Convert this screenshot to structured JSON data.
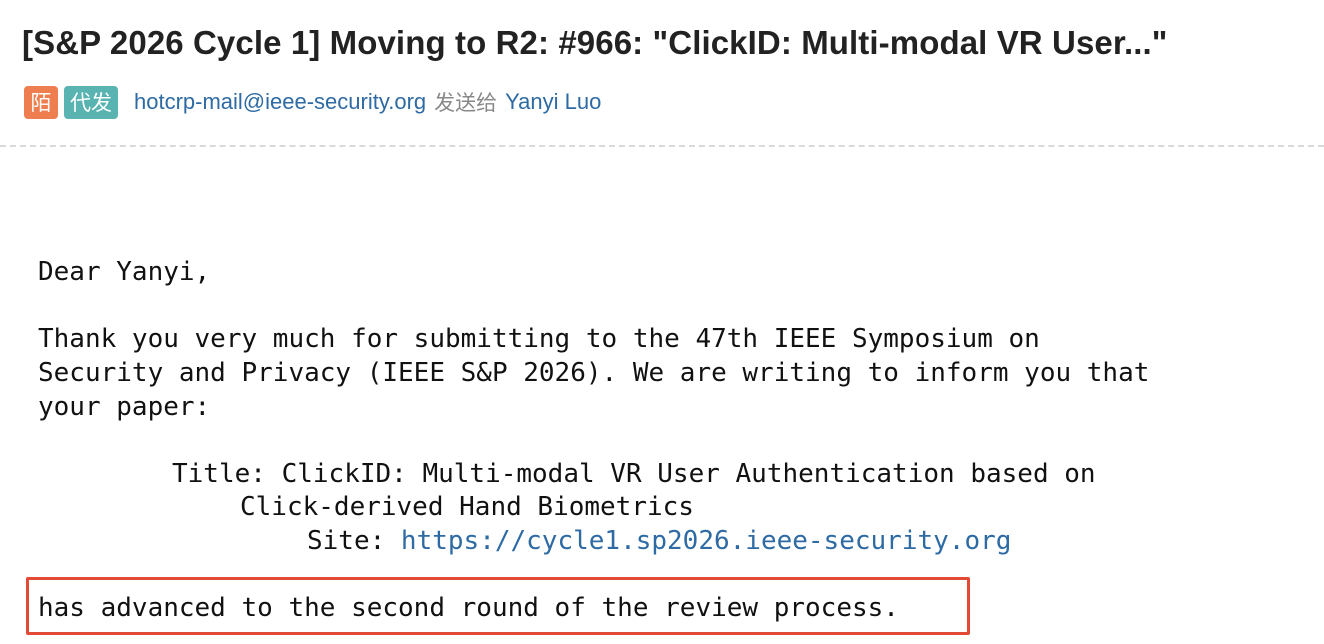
{
  "email": {
    "subject": "[S&P 2026 Cycle 1] Moving to R2: #966: \"ClickID: Multi-modal VR User...\"",
    "tags": {
      "stranger": "陌",
      "proxy": "代发"
    },
    "sender": "hotcrp-mail@ieee-security.org",
    "sent_to_label": "发送给",
    "recipient": "Yanyi Luo"
  },
  "body": {
    "greeting": "Dear Yanyi,",
    "paragraph_lines": [
      "Thank you very much for submitting to the 47th IEEE Symposium on",
      "Security and Privacy (IEEE S&P 2026). We are writing to inform you that",
      "your paper:"
    ],
    "title_label": "Title: ",
    "title_line1": "ClickID: Multi-modal VR User Authentication based on",
    "title_line2": "Click-derived Hand Biometrics",
    "site_label": "Site: ",
    "site_url": "https://cycle1.sp2026.ieee-security.org",
    "result": "has advanced to the second round of the review process."
  },
  "colors": {
    "link": "#2e6aa3",
    "tag_stranger": "#ee7e4f",
    "tag_proxy": "#58b3b1",
    "highlight_border": "#e34a34"
  }
}
